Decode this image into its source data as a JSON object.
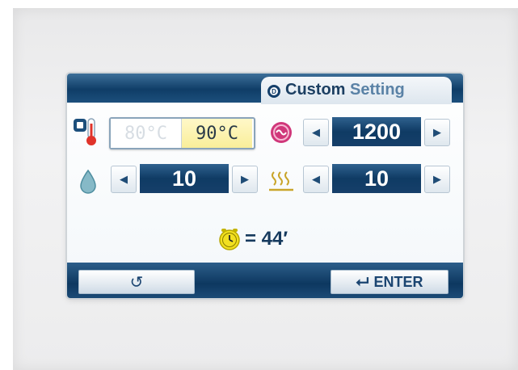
{
  "header": {
    "title_prefix": "Custom ",
    "title_suffix": "Setting",
    "mode_letter": "D"
  },
  "temperature": {
    "options": [
      "80°C",
      "90°C"
    ],
    "selected": "90°C"
  },
  "speed": {
    "value": "1200",
    "decrease": "◀",
    "increase": "▶"
  },
  "water": {
    "value": "10",
    "decrease": "◀",
    "increase": "▶"
  },
  "steam": {
    "value": "10",
    "decrease": "◀",
    "increase": "▶"
  },
  "timer": {
    "text": "= 44′"
  },
  "footer": {
    "back_symbol": "↺",
    "enter_label": "ENTER",
    "enter_arrow": "⮠"
  },
  "colors": {
    "bar_blue": "#0f3d67",
    "selected_yellow": "#f9ee9a",
    "timer_yellow": "#f2e020",
    "speed_pink": "#d0377a"
  },
  "icons": [
    "mode-d-icon",
    "thermometer-icon",
    "speed-icon",
    "water-drop-icon",
    "steam-icon",
    "timer-clock-icon",
    "back-arrow-icon",
    "enter-arrow-icon"
  ]
}
